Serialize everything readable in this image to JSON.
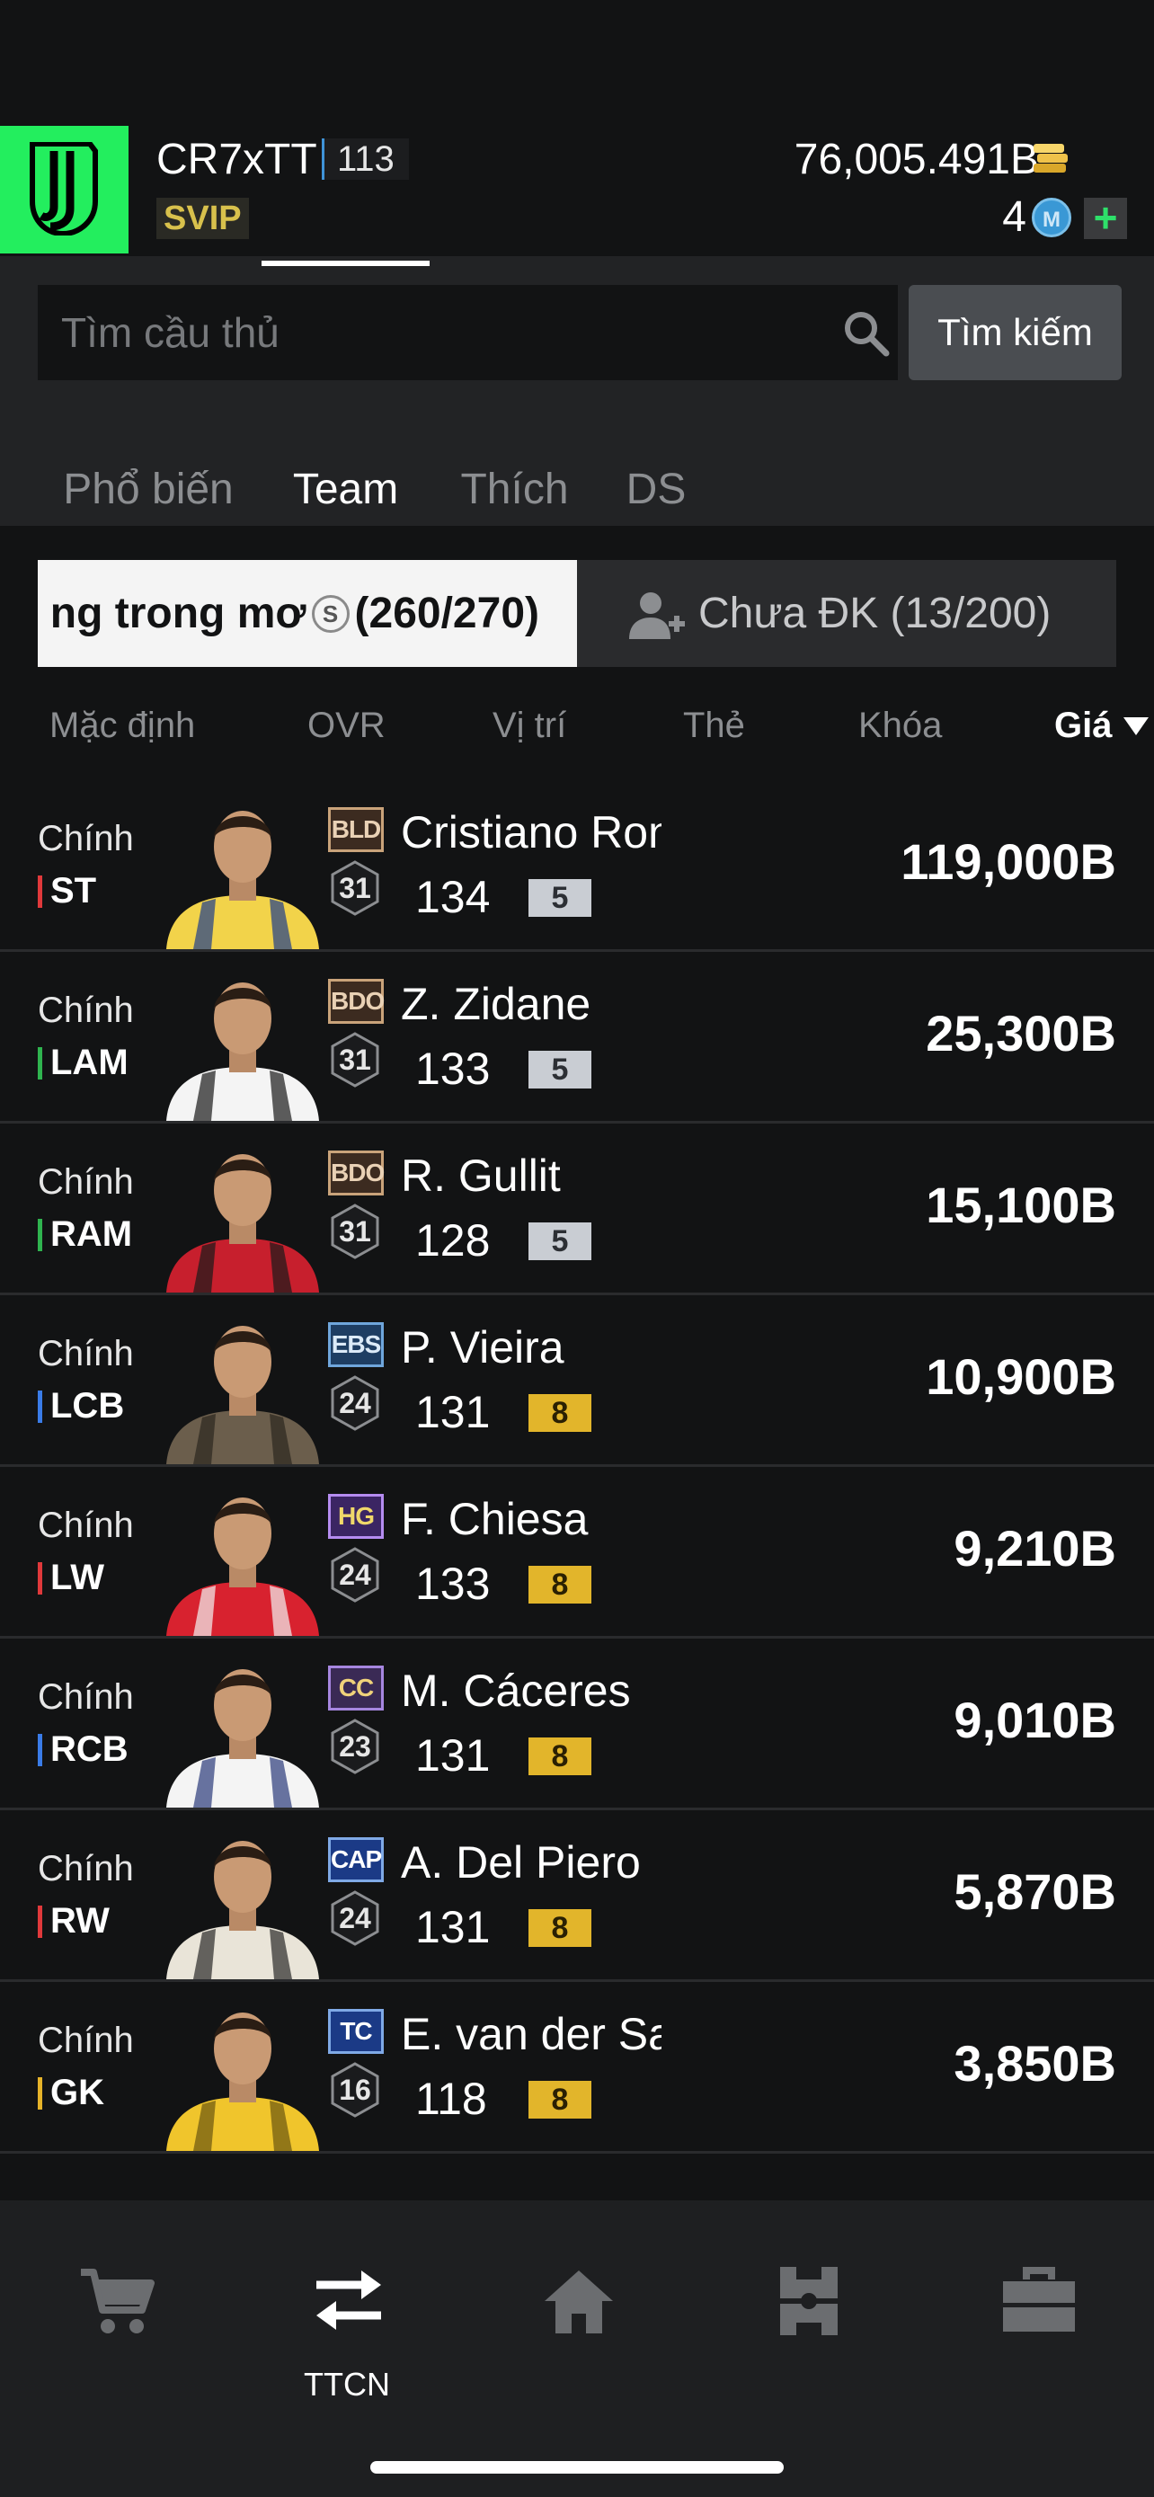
{
  "header": {
    "username": "CR7xTT",
    "level": "113",
    "vip": "SVIP",
    "coins": "76,005.491B",
    "tokens": "4",
    "token_symbol": "M",
    "add_symbol": "+"
  },
  "search": {
    "placeholder": "Tìm cầu thủ",
    "button_label": "Tìm kiếm"
  },
  "tabs": [
    {
      "label": "Phổ biến",
      "active": false
    },
    {
      "label": "Team",
      "active": true
    },
    {
      "label": "Thích",
      "active": false
    },
    {
      "label": "DS",
      "active": false
    }
  ],
  "chips": {
    "dream_label": "ng trong mơ",
    "dream_symbol": "S",
    "dream_count": "(260/270)",
    "unregistered_label": "Chưa ĐK (13/200)"
  },
  "sort": {
    "items": [
      "Mặc định",
      "OVR",
      "Vị trí",
      "Thẻ",
      "Khóa",
      "Giá"
    ],
    "active": "Giá",
    "direction": "descending"
  },
  "players": [
    {
      "role": "Chính",
      "position": "ST",
      "pos_color": "#e0393b",
      "card": "BLD",
      "card_style": "bronze",
      "grade": "31",
      "name": "Cristiano Ron",
      "ovr": "134",
      "upgrade": "5",
      "upgrade_style": "silver",
      "price": "119,000B"
    },
    {
      "role": "Chính",
      "position": "LAM",
      "pos_color": "#2fb44f",
      "card": "BDO",
      "card_style": "bronze",
      "grade": "31",
      "name": "Z. Zidane",
      "ovr": "133",
      "upgrade": "5",
      "upgrade_style": "silver",
      "price": "25,300B"
    },
    {
      "role": "Chính",
      "position": "RAM",
      "pos_color": "#2fb44f",
      "card": "BDO",
      "card_style": "bronze",
      "grade": "31",
      "name": "R. Gullit",
      "ovr": "128",
      "upgrade": "5",
      "upgrade_style": "silver",
      "price": "15,100B"
    },
    {
      "role": "Chính",
      "position": "LCB",
      "pos_color": "#3a7ce8",
      "card": "EBS",
      "card_style": "blue",
      "grade": "24",
      "name": "P. Vieira",
      "ovr": "131",
      "upgrade": "8",
      "upgrade_style": "gold",
      "price": "10,900B"
    },
    {
      "role": "Chính",
      "position": "LW",
      "pos_color": "#e0393b",
      "card": "HG",
      "card_style": "purple",
      "grade": "24",
      "name": "F. Chiesa",
      "ovr": "133",
      "upgrade": "8",
      "upgrade_style": "gold",
      "price": "9,210B"
    },
    {
      "role": "Chính",
      "position": "RCB",
      "pos_color": "#3a7ce8",
      "card": "CC",
      "card_style": "violet",
      "grade": "23",
      "name": "M. Cáceres",
      "ovr": "131",
      "upgrade": "8",
      "upgrade_style": "gold",
      "price": "9,010B"
    },
    {
      "role": "Chính",
      "position": "RW",
      "pos_color": "#e0393b",
      "card": "CAP",
      "card_style": "navy",
      "grade": "24",
      "name": "A. Del Piero",
      "ovr": "131",
      "upgrade": "8",
      "upgrade_style": "gold",
      "price": "5,870B"
    },
    {
      "role": "Chính",
      "position": "GK",
      "pos_color": "#e6b329",
      "card": "TC",
      "card_style": "navy",
      "grade": "16",
      "name": "E. van der Sar",
      "ovr": "118",
      "upgrade": "8",
      "upgrade_style": "gold",
      "price": "3,850B"
    }
  ],
  "bottom_nav": [
    {
      "icon": "cart-icon",
      "label": ""
    },
    {
      "icon": "transfer-icon",
      "label": "TTCN"
    },
    {
      "icon": "home-icon",
      "label": ""
    },
    {
      "icon": "formation-icon",
      "label": ""
    },
    {
      "icon": "briefcase-icon",
      "label": ""
    }
  ]
}
